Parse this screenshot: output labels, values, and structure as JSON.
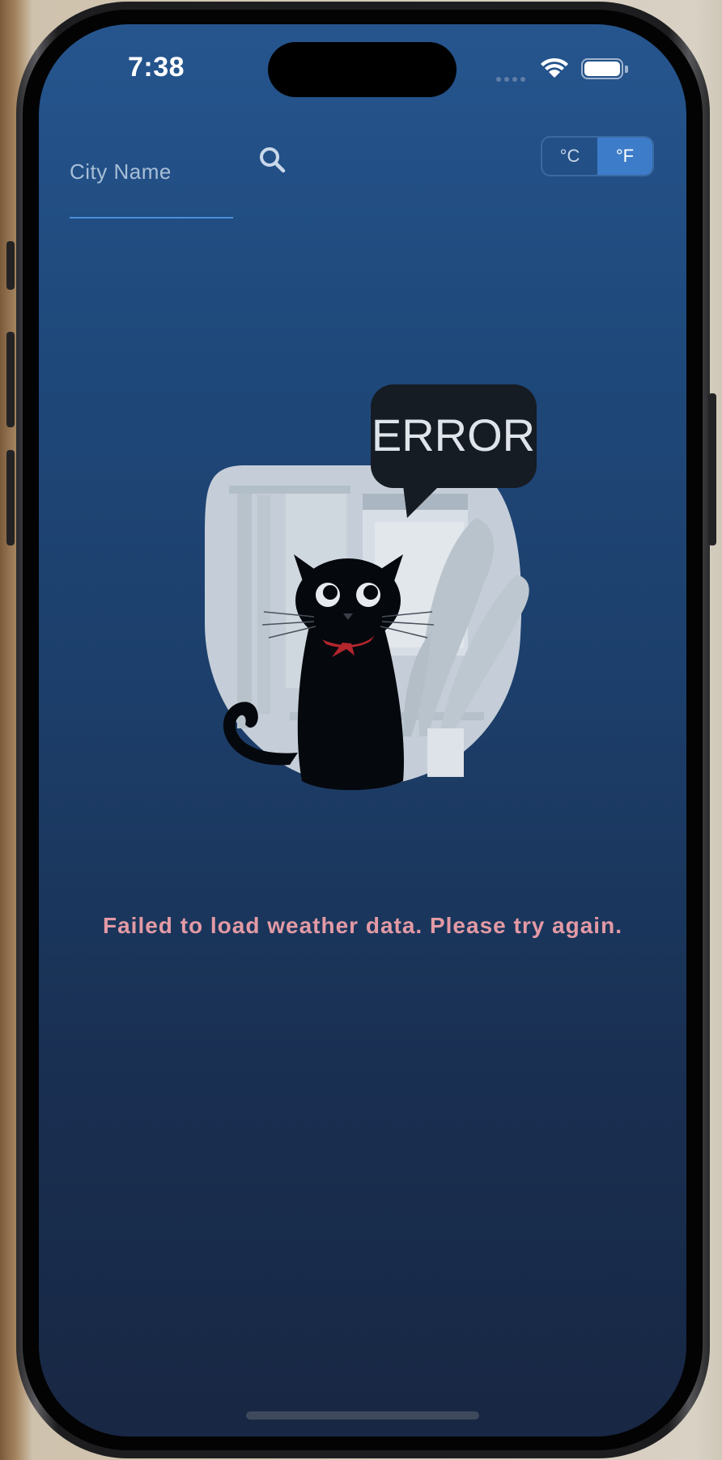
{
  "status_bar": {
    "time": "7:38"
  },
  "search": {
    "placeholder": "City Name",
    "value": ""
  },
  "units": {
    "celsius_label": "°C",
    "fahrenheit_label": "°F",
    "selected": "°F"
  },
  "illustration": {
    "bubble_text": "ERROR"
  },
  "error": {
    "message": "Failed to load weather data. Please try again."
  },
  "colors": {
    "accent": "#3d7cc9",
    "error_text": "#e39aa5",
    "background_top": "#26558e",
    "background_bottom": "#182743"
  }
}
